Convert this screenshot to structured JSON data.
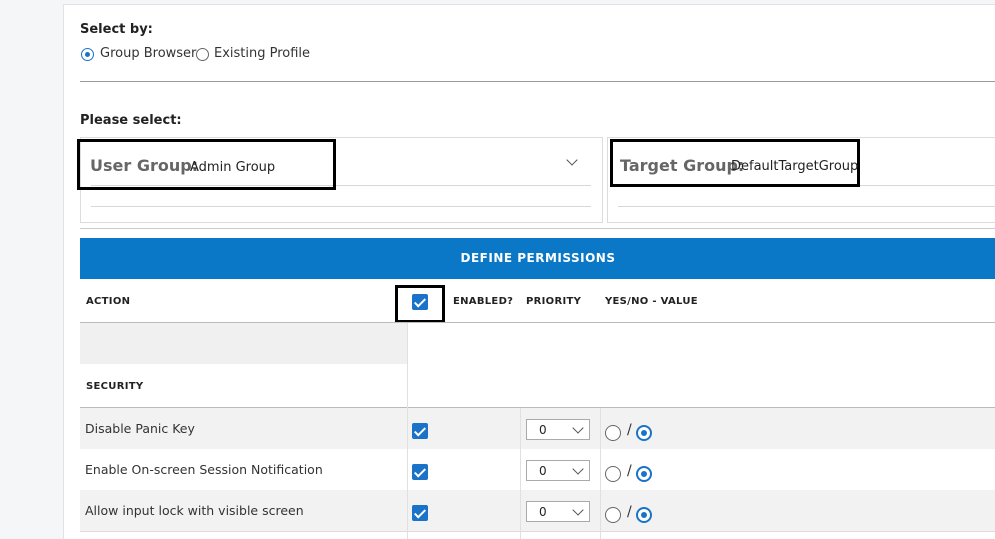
{
  "select_by": {
    "label": "Select by:",
    "options": [
      {
        "label": "Group Browser",
        "selected": true
      },
      {
        "label": "Existing Profile",
        "selected": false
      }
    ]
  },
  "please_select": {
    "label": "Please select:",
    "user_group": {
      "label": "User Group:",
      "value": "Admin Group"
    },
    "target_group": {
      "label": "Target Group:",
      "value": "DefaultTargetGroup"
    }
  },
  "permissions": {
    "header": "DEFINE PERMISSIONS",
    "columns": {
      "action": "ACTION",
      "enabled": "ENABLED?",
      "priority": "PRIORITY",
      "value": "YES/NO - VALUE"
    },
    "section": "SECURITY",
    "rows": [
      {
        "label": "Disable Panic Key",
        "enabled": true,
        "priority": "0",
        "value": "no"
      },
      {
        "label": "Enable On-screen Session Notification",
        "enabled": true,
        "priority": "0",
        "value": "no"
      },
      {
        "label": "Allow input lock with visible screen",
        "enabled": true,
        "priority": "0",
        "value": "no"
      }
    ]
  },
  "colors": {
    "accent": "#1a73c8",
    "header_bg": "#0a78c6"
  }
}
